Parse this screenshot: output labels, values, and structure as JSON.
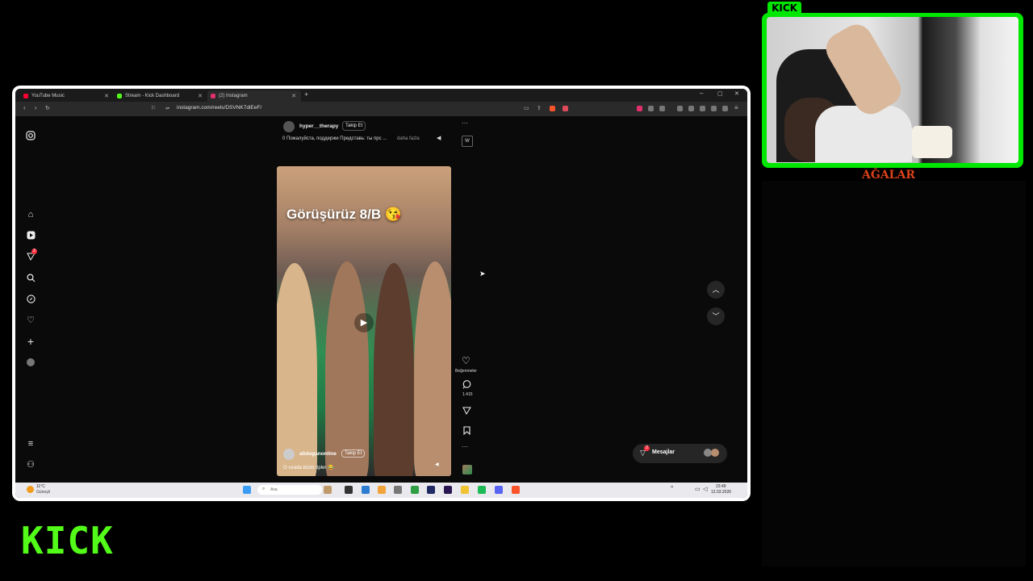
{
  "browser": {
    "tabs": [
      {
        "label": "YouTube Music",
        "color": "#ff0033"
      },
      {
        "label": "Stream - Kick Dashboard",
        "color": "#53fc18"
      },
      {
        "label": "(2) Instagram",
        "color": "#e1306c",
        "active": true
      }
    ],
    "url": "instagram.com/reels/DSVNK7diEeF/"
  },
  "instagram": {
    "sidebar": [
      "instagram-icon",
      "home-icon",
      "reels-icon",
      "send-icon",
      "search-icon",
      "explore-icon",
      "heart-icon",
      "plus-icon",
      "avatar-icon",
      "menu-icon",
      "threads-icon"
    ],
    "notification_count": "2",
    "prev_post": {
      "username": "hyper__therapy",
      "follow_label": "Takip Et",
      "caption": "0 Пожалуйста, поддержи Представь: ты прс ...",
      "more_label": "daha fazla"
    },
    "reel": {
      "overlay_text": "Görüşürüz 8/B 😘",
      "username": "alidoganonline",
      "follow_label": "Takip Et",
      "caption": "O sırada bizim tipler 😂"
    },
    "actions": {
      "likes_label": "Beğenmeler",
      "comments_count": "1.415"
    },
    "messages": {
      "label": "Mesajlar",
      "badge": "2"
    }
  },
  "taskbar": {
    "weather_temp": "11°C",
    "weather_desc": "Güneşli",
    "search_placeholder": "Ara",
    "time": "23:49",
    "date": "12.03.2026"
  },
  "overlay": {
    "kick_logo_small": "KICK",
    "kick_logo_large": "KICK",
    "cam_caption": "AĞALAR",
    "brand_color": "#53fc18"
  }
}
